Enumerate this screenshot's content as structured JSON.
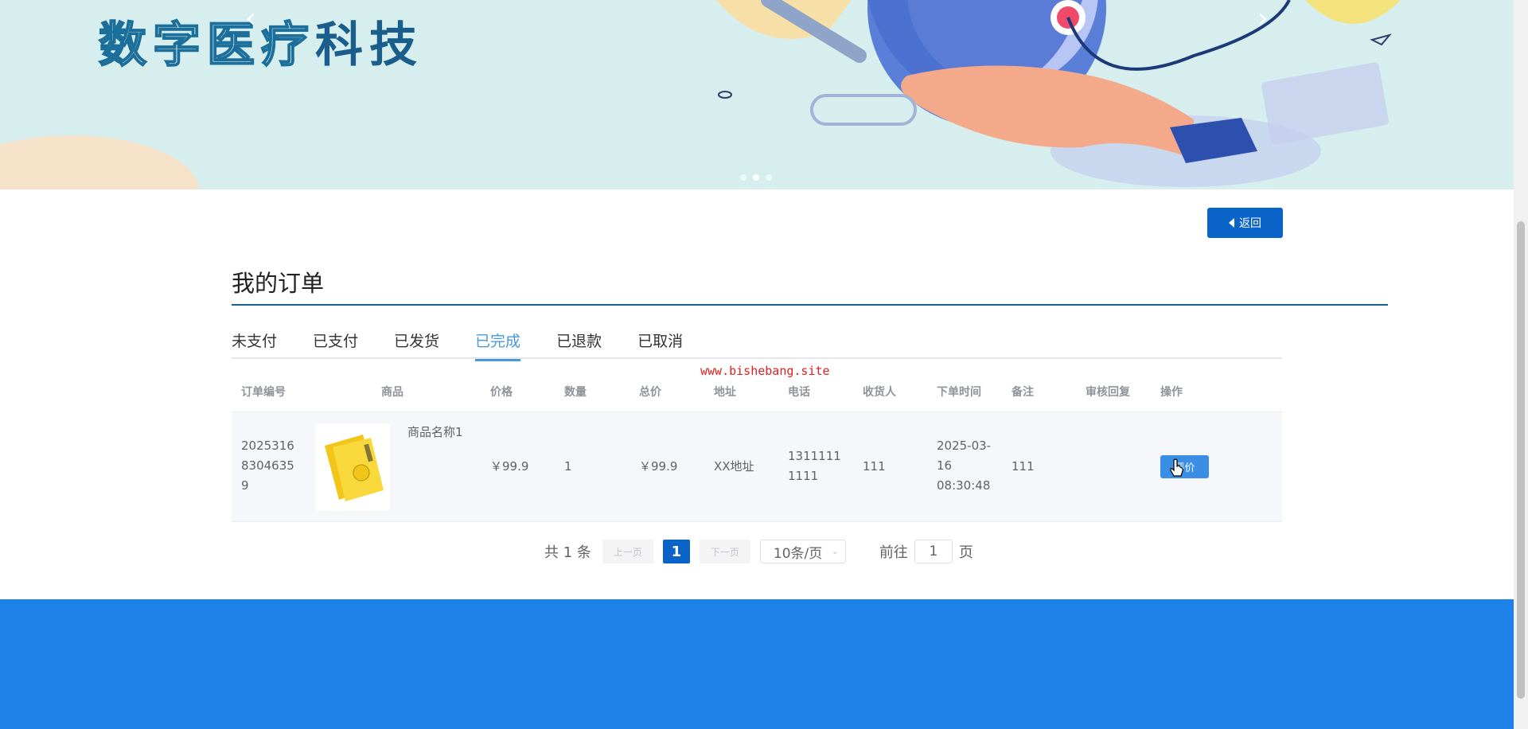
{
  "banner": {
    "title_outline": "数字医疗",
    "title_solid": "科技",
    "prev_arrow": "‹",
    "next_arrow": "›",
    "slide_count": 3,
    "active_slide": 2
  },
  "back_button": {
    "label": "返回",
    "icon": "caret-left-icon"
  },
  "page_title": "我的订单",
  "tabs": [
    {
      "label": "未支付",
      "active": false
    },
    {
      "label": "已支付",
      "active": false
    },
    {
      "label": "已发货",
      "active": false
    },
    {
      "label": "已完成",
      "active": true
    },
    {
      "label": "已退款",
      "active": false
    },
    {
      "label": "已取消",
      "active": false
    }
  ],
  "watermark": "www.bishebang.site",
  "table": {
    "headers": {
      "order_no": "订单编号",
      "goods": "商品",
      "price": "价格",
      "qty": "数量",
      "total": "总价",
      "address": "地址",
      "phone": "电话",
      "receiver": "收货人",
      "order_time": "下单时间",
      "note": "备注",
      "audit_reply": "审核回复",
      "operation": "操作"
    },
    "rows": [
      {
        "order_no": "20253168304635 9",
        "goods_name": "商品名称1",
        "price": "￥99.9",
        "qty": "1",
        "total": "￥99.9",
        "address": "XX地址",
        "phone": "13111111111",
        "receiver": "111",
        "order_time": "2025-03-16 08:30:48",
        "note": "111",
        "audit_reply": "",
        "action_label": "评价"
      }
    ]
  },
  "pagination": {
    "total": "共 1 条",
    "prev": "上一页",
    "current": "1",
    "next": "下一页",
    "page_size": "10条/页",
    "goto": "前往",
    "goto_value": "1",
    "page_suffix": "页"
  },
  "colors": {
    "primary": "#0a64c8",
    "tab_active": "#4a98d8",
    "footer": "#1e83e8",
    "banner_bg": "#d6eeee",
    "watermark": "#e02020"
  }
}
